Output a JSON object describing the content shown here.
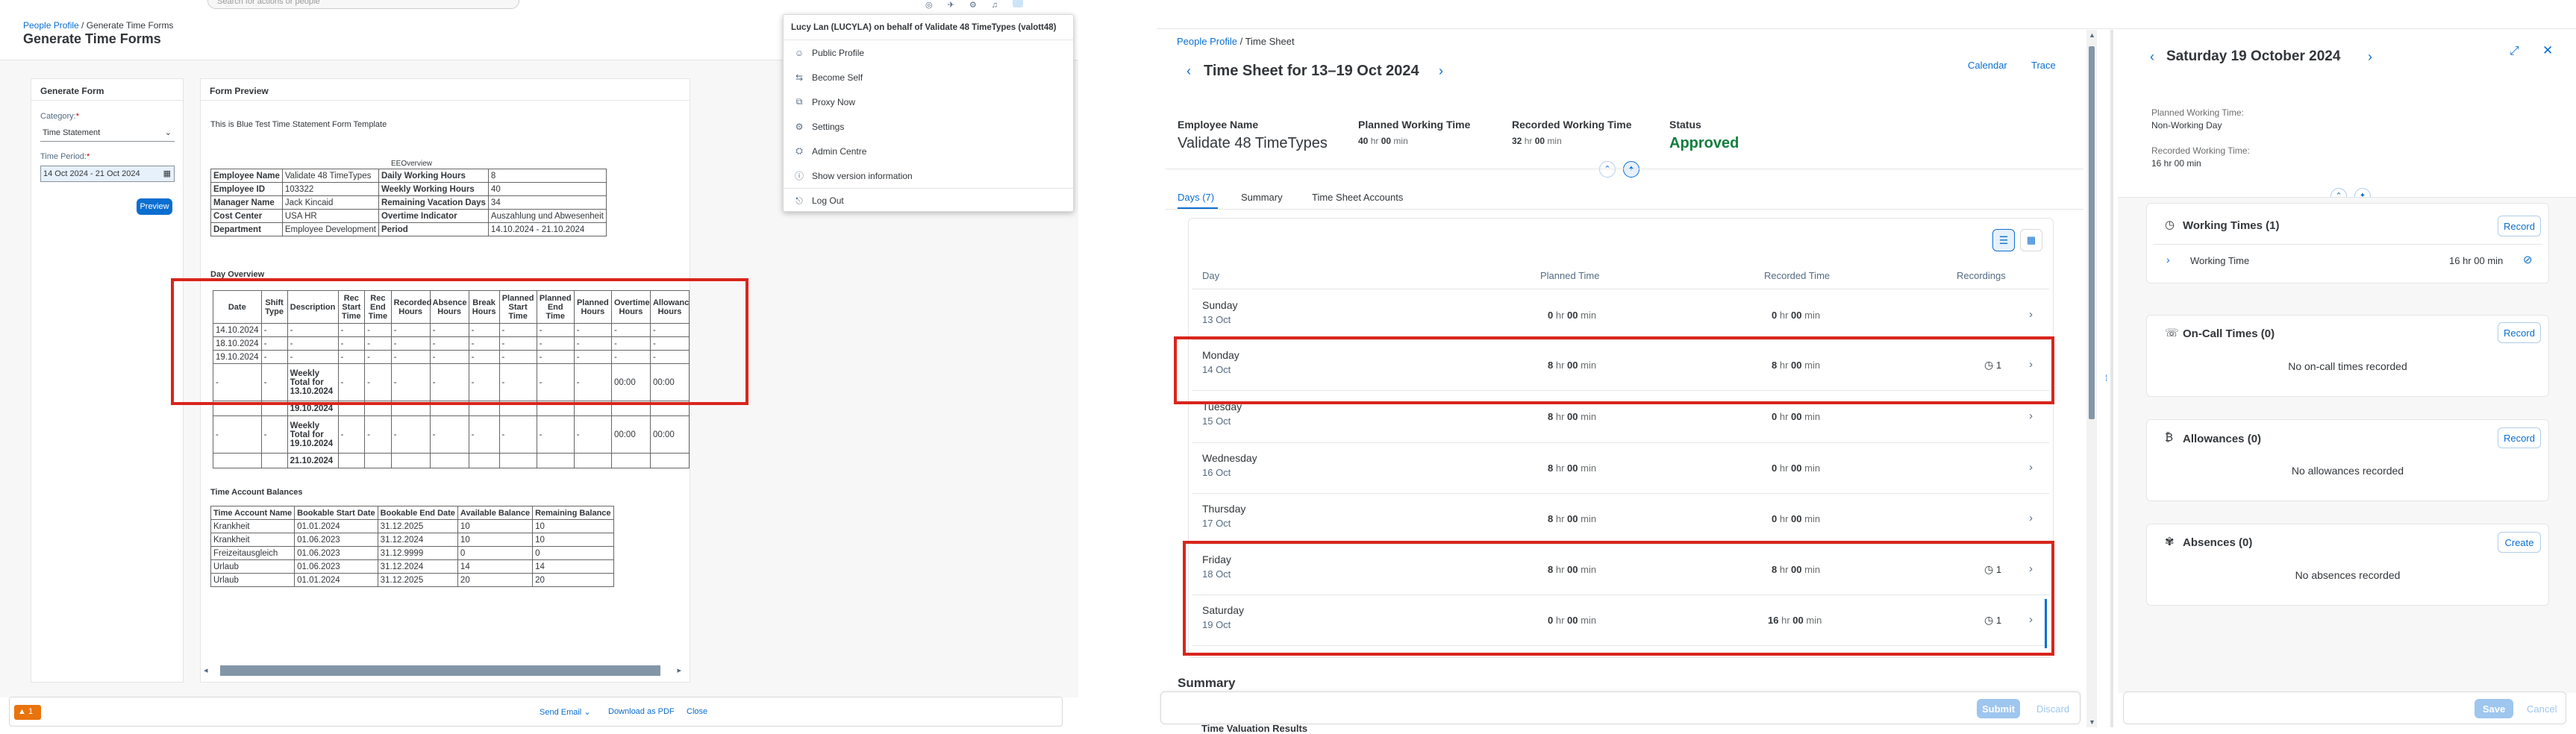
{
  "left": {
    "breadcrumb_root": "People Profile",
    "breadcrumb_sep": " / ",
    "breadcrumb_current": "Generate Time Forms",
    "title": "Generate Time Forms",
    "search_placeholder": "Search for actions or people",
    "generate_form": {
      "heading": "Generate Form",
      "category_label": "Category:",
      "category_value": "Time Statement",
      "period_label": "Time Period:",
      "period_value": "14 Oct 2024 - 21 Oct 2024",
      "preview_btn": "Preview"
    },
    "preview": {
      "heading": "Form Preview",
      "template_title": "This is Blue Test Time Statement Form Template",
      "ee_overview": "EEOverview",
      "info_rows": [
        [
          "Employee Name",
          "Validate 48 TimeTypes",
          "Daily Working Hours",
          "8"
        ],
        [
          "Employee ID",
          "103322",
          "Weekly Working Hours",
          "40"
        ],
        [
          "Manager Name",
          "Jack Kincaid",
          "Remaining Vacation Days",
          "34"
        ],
        [
          "Cost Center",
          "USA HR",
          "Overtime Indicator",
          "Auszahlung und Abwesenheit"
        ],
        [
          "Department",
          "Employee Development",
          "Period",
          "14.10.2024 - 21.10.2024"
        ]
      ],
      "day_overview": "Day Overview",
      "day_headers": [
        "Date",
        "Shift Type",
        "Description",
        "Rec Start Time",
        "Rec End Time",
        "Recorded Hours",
        "Absence Hours",
        "Break Hours",
        "Planned Start Time",
        "Planned End Time",
        "Planned Hours",
        "Overtime Hours",
        "Allowance Hours"
      ],
      "day_rows": [
        [
          "14.10.2024",
          "-",
          "-",
          "-",
          "-",
          "-",
          "-",
          "-",
          "-",
          "-",
          "-",
          "-",
          "-"
        ],
        [
          "18.10.2024",
          "-",
          "-",
          "-",
          "-",
          "-",
          "-",
          "-",
          "-",
          "-",
          "-",
          "-",
          "-"
        ],
        [
          "19.10.2024",
          "-",
          "-",
          "-",
          "-",
          "-",
          "-",
          "-",
          "-",
          "-",
          "-",
          "-",
          "-"
        ]
      ],
      "weekly_rows": [
        {
          "label": "Weekly Total for 13.10.2024",
          "overtime": "00:00",
          "allowance": "00:00"
        },
        {
          "label": "19.10.2024",
          "overtime": "",
          "allowance": ""
        },
        {
          "label": "Weekly Total for 19.10.2024",
          "overtime": "00:00",
          "allowance": "00:00"
        },
        {
          "label": "21.10.2024",
          "overtime": "",
          "allowance": ""
        }
      ],
      "account_heading": "Time Account Balances",
      "account_headers": [
        "Time Account Name",
        "Bookable Start Date",
        "Bookable End Date",
        "Available Balance",
        "Remaining Balance"
      ],
      "account_rows": [
        [
          "Krankheit",
          "01.01.2024",
          "31.12.2025",
          "10",
          "10"
        ],
        [
          "Krankheit",
          "01.06.2023",
          "31.12.2024",
          "10",
          "10"
        ],
        [
          "Freizeitausgleich",
          "01.06.2023",
          "31.12.9999",
          "0",
          "0"
        ],
        [
          "Urlaub",
          "01.06.2023",
          "31.12.2024",
          "14",
          "14"
        ],
        [
          "Urlaub",
          "01.01.2024",
          "31.12.2025",
          "20",
          "20"
        ]
      ]
    },
    "footer": {
      "warning_count": "1",
      "send_email": "Send Email",
      "download_pdf": "Download as PDF",
      "close": "Close"
    },
    "user_menu": {
      "header": "Lucy Lan (LUCYLA) on behalf of Validate 48 TimeTypes (valott48)",
      "items": [
        "Public Profile",
        "Become Self",
        "Proxy Now",
        "Settings",
        "Admin Centre",
        "Show version information",
        "Log Out"
      ]
    }
  },
  "right": {
    "breadcrumb_root": "People Profile",
    "breadcrumb_sep": " / ",
    "breadcrumb_current": "Time Sheet",
    "title": "Time Sheet for 13–19 Oct 2024",
    "calendar_link": "Calendar",
    "trace_link": "Trace",
    "emp_name_label": "Employee Name",
    "emp_name_value": "Validate 48 TimeTypes",
    "planned_label": "Planned Working Time",
    "planned_value": {
      "h": "40",
      "hu": "hr",
      "m": "00",
      "mu": "min"
    },
    "recorded_label": "Recorded Working Time",
    "recorded_value": {
      "h": "32",
      "hu": "hr",
      "m": "00",
      "mu": "min"
    },
    "status_label": "Status",
    "status_value": "Approved",
    "tabs": [
      "Days (7)",
      "Summary",
      "Time Sheet Accounts"
    ],
    "col_day": "Day",
    "col_planned": "Planned Time",
    "col_recorded": "Recorded Time",
    "col_recordings": "Recordings",
    "days": [
      {
        "day": "Sunday",
        "date": "13 Oct",
        "ph": "0",
        "pm": "00",
        "rh": "0",
        "rm": "00",
        "rec": ""
      },
      {
        "day": "Monday",
        "date": "14 Oct",
        "ph": "8",
        "pm": "00",
        "rh": "8",
        "rm": "00",
        "rec": "1"
      },
      {
        "day": "Tuesday",
        "date": "15 Oct",
        "ph": "8",
        "pm": "00",
        "rh": "0",
        "rm": "00",
        "rec": ""
      },
      {
        "day": "Wednesday",
        "date": "16 Oct",
        "ph": "8",
        "pm": "00",
        "rh": "0",
        "rm": "00",
        "rec": ""
      },
      {
        "day": "Thursday",
        "date": "17 Oct",
        "ph": "8",
        "pm": "00",
        "rh": "0",
        "rm": "00",
        "rec": ""
      },
      {
        "day": "Friday",
        "date": "18 Oct",
        "ph": "8",
        "pm": "00",
        "rh": "8",
        "rm": "00",
        "rec": "1"
      },
      {
        "day": "Saturday",
        "date": "19 Oct",
        "ph": "0",
        "pm": "00",
        "rh": "16",
        "rm": "00",
        "rec": "1"
      }
    ],
    "hr": "hr",
    "min": "min",
    "summary_heading": "Summary",
    "time_valuation": "Time Valuation Results",
    "submit": "Submit",
    "discard": "Discard"
  },
  "detail": {
    "title": "Saturday 19 October 2024",
    "planned_label": "Planned Working Time:",
    "planned_value": "Non-Working Day",
    "recorded_label": "Recorded Working Time:",
    "recorded_value": "16 hr 00 min",
    "working_times": "Working Times (1)",
    "working_time_row": "Working Time",
    "working_time_value": "16 hr 00 min",
    "record": "Record",
    "on_call": "On-Call Times (0)",
    "on_call_empty": "No on-call times recorded",
    "allowances": "Allowances (0)",
    "allowances_empty": "No allowances recorded",
    "absences": "Absences (0)",
    "create": "Create",
    "absences_empty": "No absences recorded",
    "save": "Save",
    "cancel": "Cancel"
  }
}
